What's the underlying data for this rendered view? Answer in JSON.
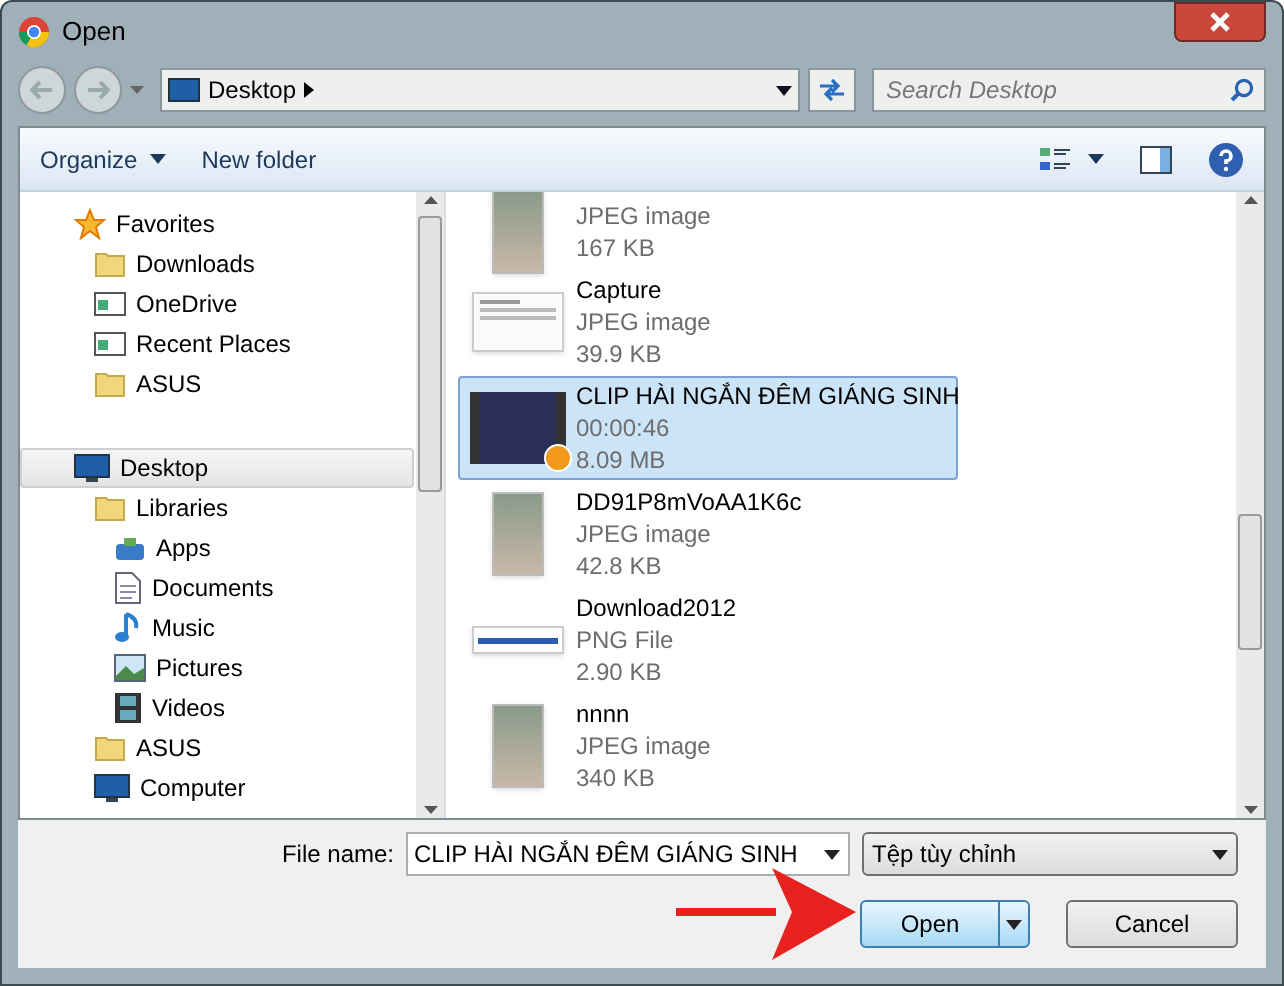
{
  "window": {
    "title": "Open"
  },
  "address": {
    "location": "Desktop",
    "search_placeholder": "Search Desktop"
  },
  "toolbar": {
    "organize": "Organize",
    "new_folder": "New folder"
  },
  "navigation": [
    {
      "label": "Favorites",
      "kind": "star",
      "selected": false,
      "children": [
        {
          "label": "Downloads",
          "kind": "folder",
          "selected": false
        },
        {
          "label": "OneDrive",
          "kind": "window",
          "selected": false
        },
        {
          "label": "Recent Places",
          "kind": "window",
          "selected": false
        },
        {
          "label": "ASUS",
          "kind": "folder",
          "selected": false
        }
      ]
    },
    {
      "label": "Desktop",
      "kind": "monitor",
      "selected": true,
      "children": [
        {
          "label": "Libraries",
          "kind": "folder",
          "selected": false,
          "children": [
            {
              "label": "Apps",
              "kind": "bag",
              "selected": false
            },
            {
              "label": "Documents",
              "kind": "document",
              "selected": false
            },
            {
              "label": "Music",
              "kind": "note",
              "selected": false
            },
            {
              "label": "Pictures",
              "kind": "picture",
              "selected": false
            },
            {
              "label": "Videos",
              "kind": "film",
              "selected": false
            }
          ]
        },
        {
          "label": "ASUS",
          "kind": "folder",
          "selected": false
        },
        {
          "label": "Computer",
          "kind": "monitor",
          "selected": false
        }
      ]
    }
  ],
  "files": [
    {
      "type": "JPEG image",
      "size": "167 KB",
      "kind": "photo",
      "selected": false
    },
    {
      "name": "Capture",
      "type": "JPEG image",
      "size": "39.9 KB",
      "kind": "document",
      "selected": false
    },
    {
      "name": "CLIP HÀI NGẮN ĐÊM GIÁNG SINH",
      "type": "00:00:46",
      "size": "8.09 MB",
      "kind": "video",
      "selected": true
    },
    {
      "name": "DD91P8mVoAA1K6c",
      "type": "JPEG image",
      "size": "42.8 KB",
      "kind": "photo",
      "selected": false
    },
    {
      "name": "Download2012",
      "type": "PNG File",
      "size": "2.90 KB",
      "kind": "banner",
      "selected": false
    },
    {
      "name": "nnnn",
      "type": "JPEG image",
      "size": "340 KB",
      "kind": "photo",
      "selected": false
    }
  ],
  "file_name": {
    "label": "File name:",
    "value": "CLIP HÀI NGẮN ĐÊM GIÁNG SINH"
  },
  "file_type": {
    "value": "Tệp tùy chỉnh"
  },
  "buttons": {
    "open": "Open",
    "cancel": "Cancel"
  }
}
